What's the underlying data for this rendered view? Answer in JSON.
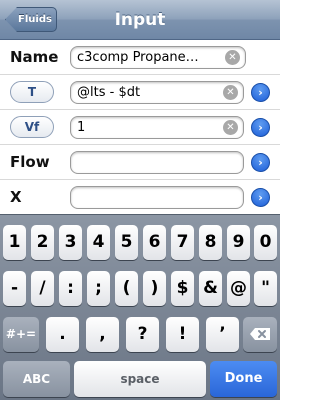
{
  "navbar": {
    "back_label": "Fluids",
    "title": "Input"
  },
  "rows": [
    {
      "label": "Name",
      "value": "c3comp Propane…",
      "has_clear": true,
      "has_disclosure": false
    },
    {
      "button": "T",
      "value": "@lts - $dt",
      "has_clear": true,
      "has_disclosure": true
    },
    {
      "button": "Vf",
      "value": "1",
      "has_clear": true,
      "has_disclosure": true
    },
    {
      "label": "Flow",
      "value": "",
      "has_clear": false,
      "has_disclosure": true
    },
    {
      "label": "X",
      "value": "",
      "has_clear": false,
      "has_disclosure": true
    }
  ],
  "icons": {
    "clear": "clear-circle-icon",
    "disclosure": "chevron-right-circle-icon",
    "backspace": "backspace-icon"
  },
  "keyboard": {
    "row1": [
      "1",
      "2",
      "3",
      "4",
      "5",
      "6",
      "7",
      "8",
      "9",
      "0"
    ],
    "row2": [
      "-",
      "/",
      ":",
      ";",
      "(",
      ")",
      "$",
      "&",
      "@",
      "\""
    ],
    "row3_mode": "#+=",
    "row3": [
      ".",
      ",",
      "?",
      "!",
      "’"
    ],
    "abc": "ABC",
    "space": "space",
    "done": "Done"
  },
  "colors": {
    "nav": "#7d93af",
    "disclosure": "#1c5ed8",
    "done": "#2a66d8",
    "keyboard_bg": "#7a8493"
  }
}
